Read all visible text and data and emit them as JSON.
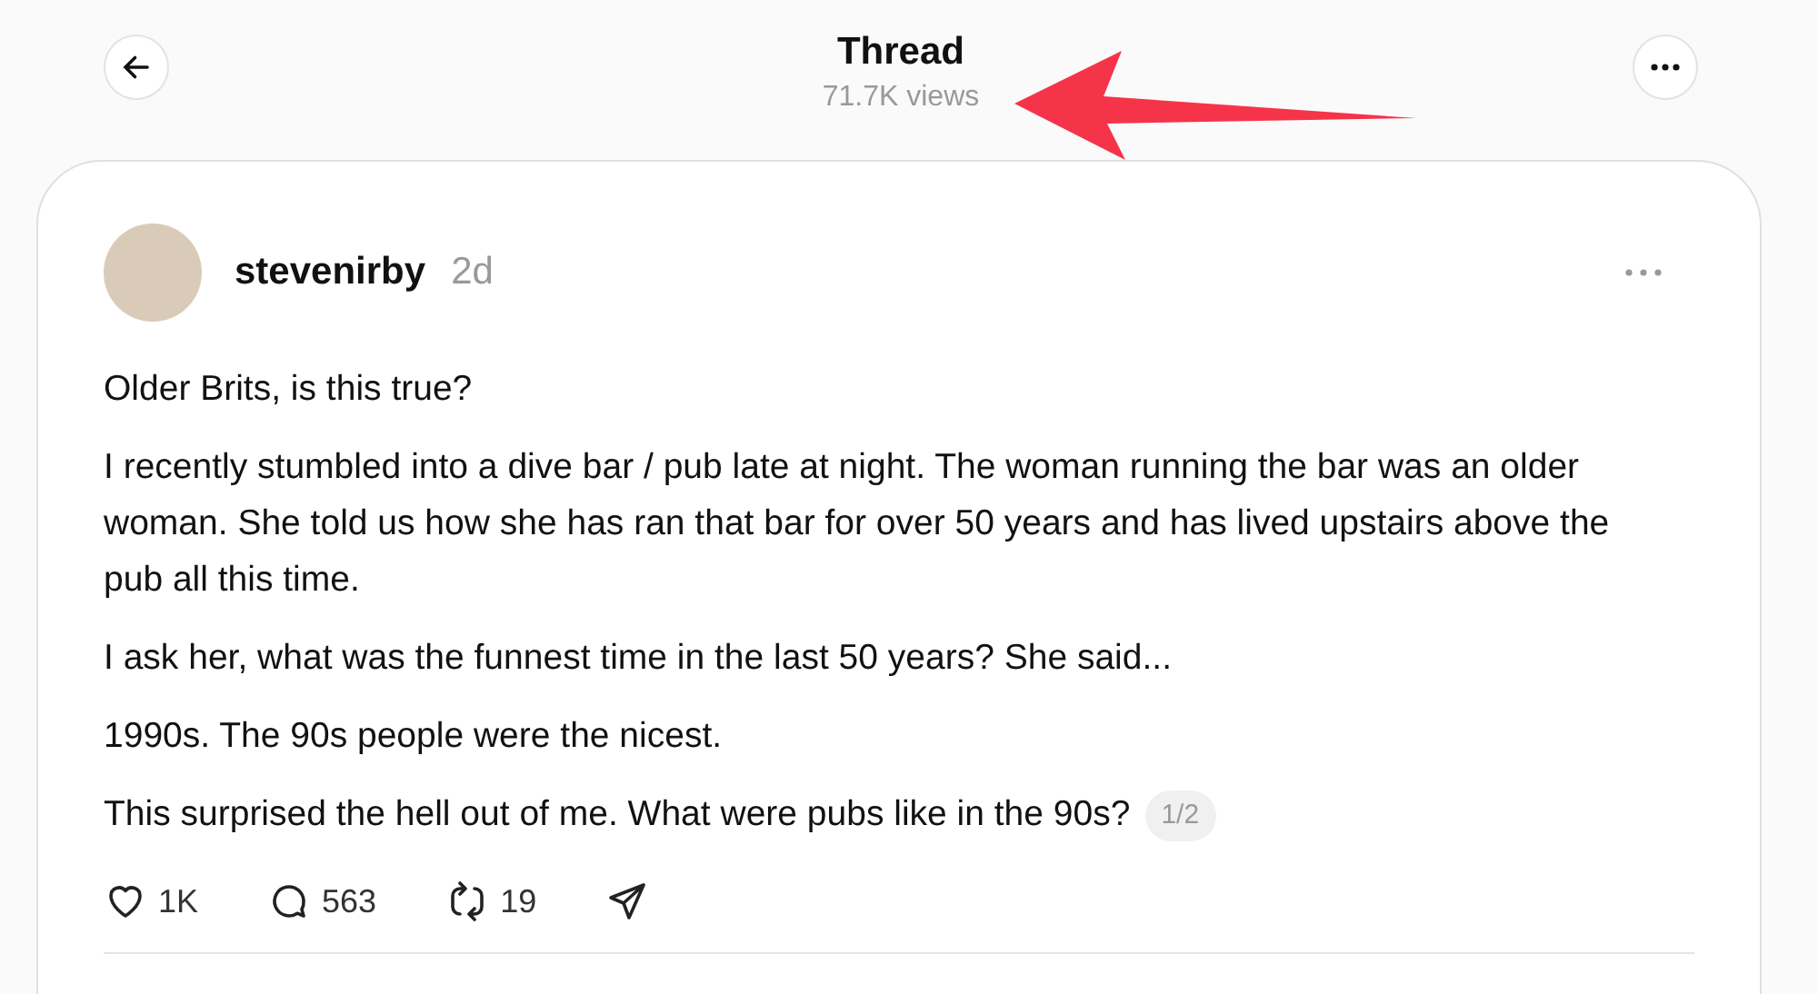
{
  "header": {
    "title": "Thread",
    "views": "71.7K views"
  },
  "post": {
    "author": "stevenirby",
    "time": "2d",
    "paragraphs": [
      "Older Brits, is this true?",
      "I recently stumbled into a dive bar / pub late at night. The woman running the bar was an older woman. She told us how she has ran that bar for over 50 years and has lived upstairs above the pub all this time.",
      "I ask her, what was the funnest time in the last 50 years? She said...",
      "1990s. The 90s people were the nicest.",
      "This surprised the hell out of me. What were pubs like in the 90s?"
    ],
    "page_badge": "1/2",
    "actions": [
      {
        "kind": "like",
        "count": "1K"
      },
      {
        "kind": "reply",
        "count": "563"
      },
      {
        "kind": "repost",
        "count": "19"
      },
      {
        "kind": "share"
      }
    ]
  }
}
